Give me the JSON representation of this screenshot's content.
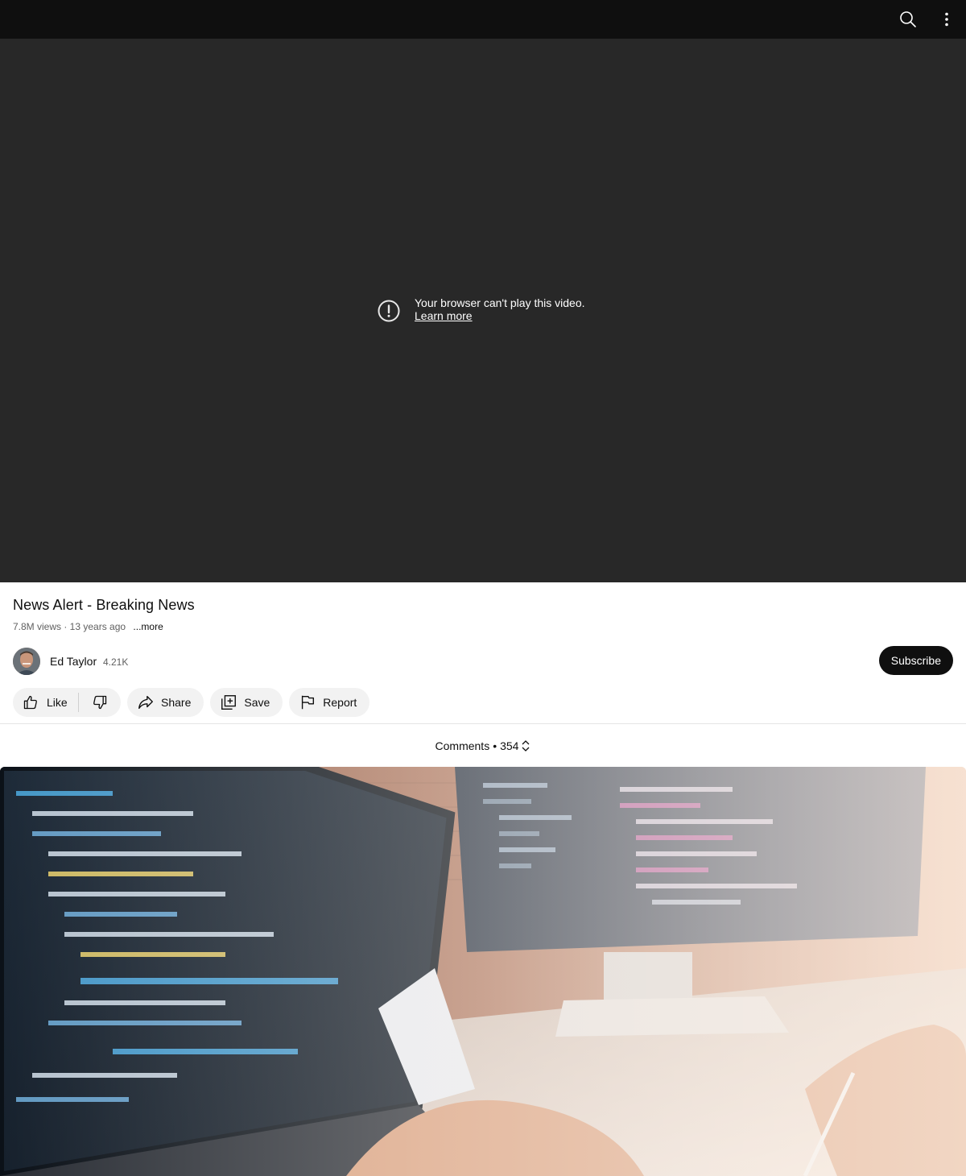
{
  "icons": {
    "search": "search-icon",
    "more": "more-vert-icon",
    "error": "alert-circle-icon",
    "like": "thumb-up-icon",
    "dislike": "thumb-down-icon",
    "share": "share-arrow-icon",
    "save": "playlist-add-icon",
    "report": "flag-icon",
    "sort": "sort-updown-icon"
  },
  "colors": {
    "topbar": "#0f0f0f",
    "player_bg": "#282828",
    "pill_bg": "#f2f2f2",
    "subscribe_bg": "#0f0f0f",
    "secondary_text": "#606060"
  },
  "player": {
    "error_message": "Your browser can't play this video.",
    "learn_more": "Learn more"
  },
  "video": {
    "title": "News Alert - Breaking News",
    "views_age": "7.8M views · 13 years ago",
    "more_label": "...more"
  },
  "channel": {
    "name": "Ed Taylor",
    "subscribers": "4.21K",
    "subscribe_label": "Subscribe"
  },
  "actions": {
    "like": "Like",
    "share": "Share",
    "save": "Save",
    "report": "Report"
  },
  "comments": {
    "label": "Comments",
    "separator": "•",
    "count": "354"
  }
}
